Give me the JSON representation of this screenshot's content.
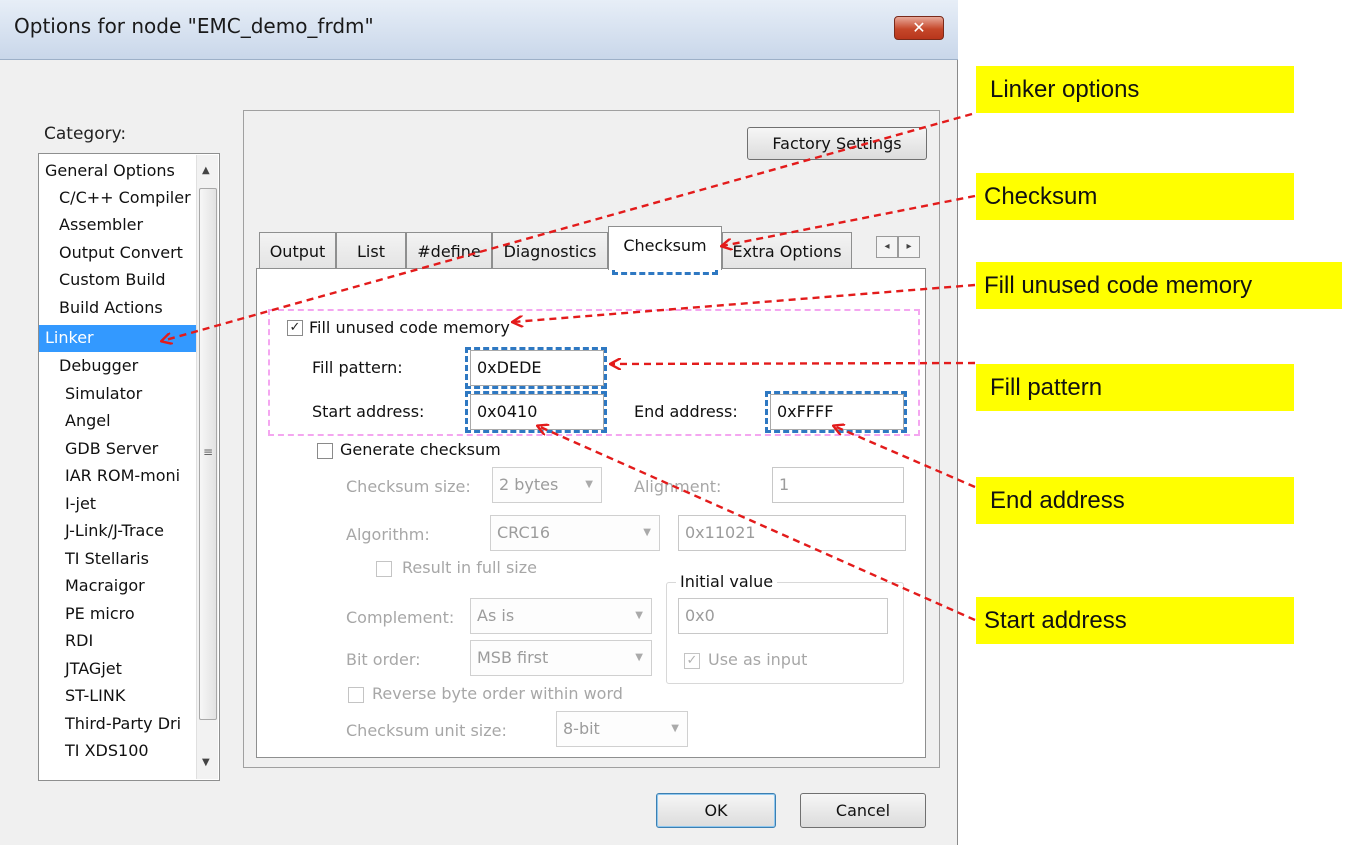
{
  "window": {
    "title": "Options for node \"EMC_demo_frdm\"",
    "close_glyph": "✕"
  },
  "category": {
    "label": "Category:",
    "items": [
      "General Options",
      "C/C++ Compiler",
      "Assembler",
      "Output Convert",
      "Custom Build",
      "Build Actions",
      "Linker",
      "Debugger",
      "Simulator",
      "Angel",
      "GDB Server",
      "IAR ROM-moni",
      "I-jet",
      "J-Link/J-Trace",
      "TI Stellaris",
      "Macraigor",
      "PE micro",
      "RDI",
      "JTAGjet",
      "ST-LINK",
      "Third-Party Dri",
      "TI XDS100"
    ],
    "selected": "Linker"
  },
  "factory_settings": "Factory Settings",
  "tabs": [
    "Output",
    "List",
    "#define",
    "Diagnostics",
    "Checksum",
    "Extra Options"
  ],
  "active_tab": "Checksum",
  "fill": {
    "checkbox_label": "Fill unused code memory",
    "checked": true,
    "pattern_label": "Fill pattern:",
    "pattern_value": "0xDEDE",
    "start_label": "Start address:",
    "start_value": "0x0410",
    "end_label": "End address:",
    "end_value": "0xFFFF"
  },
  "checksum": {
    "generate_label": "Generate checksum",
    "generate_checked": false,
    "size_label": "Checksum size:",
    "size_value": "2 bytes",
    "alignment_label": "Alignment:",
    "alignment_value": "1",
    "algorithm_label": "Algorithm:",
    "algorithm_value": "CRC16",
    "poly_value": "0x11021",
    "full_size_label": "Result in full size",
    "initial_group": "Initial value",
    "initial_value": "0x0",
    "use_input_label": "Use as input",
    "complement_label": "Complement:",
    "complement_value": "As is",
    "bit_order_label": "Bit order:",
    "bit_order_value": "MSB first",
    "reverse_label": "Reverse byte order within word",
    "unit_size_label": "Checksum unit size:",
    "unit_size_value": "8-bit"
  },
  "buttons": {
    "ok": "OK",
    "cancel": "Cancel"
  },
  "callouts": [
    "Linker options",
    "Checksum",
    "Fill unused code memory",
    "Fill pattern",
    "End address",
    "Start address"
  ],
  "colors": {
    "callout_bg": "#ffff00",
    "arrow": "#e31b1b",
    "highlight_blue": "#2e78c2",
    "highlight_pink": "#f4a6f0",
    "selection": "#3399ff"
  }
}
